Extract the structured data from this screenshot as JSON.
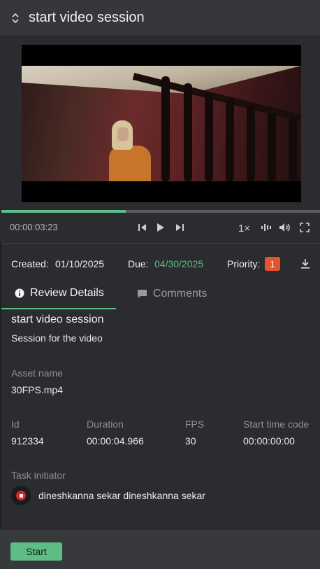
{
  "header": {
    "title": "start video session"
  },
  "player": {
    "timecode": "00:00:03:23",
    "speed": "1×",
    "progress_percent": 39
  },
  "meta": {
    "created_label": "Created:",
    "created_value": "01/10/2025",
    "due_label": "Due:",
    "due_value": "04/30/2025",
    "priority_label": "Priority:",
    "priority_value": "1"
  },
  "tabs": [
    {
      "label": "Review Details",
      "icon": "info-icon",
      "active": true
    },
    {
      "label": "Comments",
      "icon": "comment-icon",
      "active": false
    }
  ],
  "details": {
    "title": "start video session",
    "description": "Session for the video",
    "asset_label": "Asset name",
    "asset_value": "30FPS.mp4",
    "id_label": "Id",
    "id_value": "912334",
    "duration_label": "Duration",
    "duration_value": "00:00:04.966",
    "fps_label": "FPS",
    "fps_value": "30",
    "stc_label": "Start time code",
    "stc_value": "00:00:00:00",
    "initiator_label": "Task initiator",
    "initiator_name": "dineshkanna sekar dineshkanna sekar"
  },
  "footer": {
    "start_label": "Start"
  },
  "colors": {
    "accent": "#5ebd85",
    "priority": "#e3552f",
    "background": "#2b2c2f"
  }
}
